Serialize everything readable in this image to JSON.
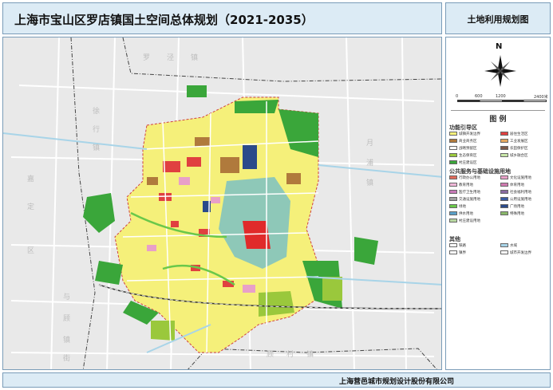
{
  "header": {
    "title": "上海市宝山区罗店镇国土空间总体规划（2021-2035）",
    "map_type": "土地利用规划图"
  },
  "footer": {
    "company": "上海营邑城市规划设计股份有限公司"
  },
  "map": {
    "watermarks": [
      {
        "text": "罗",
        "ix": 0
      },
      {
        "text": "泾",
        "ix": 1
      },
      {
        "text": "镇",
        "ix": 2
      },
      {
        "text": "徐",
        "ix": 3
      },
      {
        "text": "行",
        "ix": 4
      },
      {
        "text": "镇",
        "ix": 5
      },
      {
        "text": "嘉",
        "ix": 6
      },
      {
        "text": "定",
        "ix": 7
      },
      {
        "text": "区",
        "ix": 8
      },
      {
        "text": "与",
        "ix": 9
      },
      {
        "text": "顾",
        "ix": 10
      },
      {
        "text": "镇",
        "ix": 11
      },
      {
        "text": "街",
        "ix": 12
      },
      {
        "text": "顾",
        "ix": 13
      },
      {
        "text": "村",
        "ix": 14
      },
      {
        "text": "镇",
        "ix": 15
      },
      {
        "text": "月",
        "ix": 16
      },
      {
        "text": "浦",
        "ix": 17
      },
      {
        "text": "镇",
        "ix": 18
      }
    ]
  },
  "legend": {
    "compass_label": "N",
    "scale_labels": [
      "0",
      "600",
      "1200",
      "2400米"
    ],
    "title": "图   例",
    "section1_title": "功能引导区",
    "section1_items": [
      {
        "label": "城镇开发边界",
        "color": "#f5f07a"
      },
      {
        "label": "居住生活区",
        "color": "#e04040"
      },
      {
        "label": "商业商务区",
        "color": "#b07a3c"
      },
      {
        "label": "工业发展区",
        "color": "#e3a860"
      },
      {
        "label": "战略预留区",
        "color": "#ffffff"
      },
      {
        "label": "农田保护区",
        "color": "#7b5a4a"
      },
      {
        "label": "生态保育区",
        "color": "#9ac83c"
      },
      {
        "label": "城乡融合区",
        "color": "#c8e6a8"
      },
      {
        "label": "村庄建设区",
        "color": "#3aa63a"
      }
    ],
    "section2_title": "公共服务与基础设施用地",
    "section2_items": [
      {
        "label": "行政办公用地",
        "color": "#e06a5a"
      },
      {
        "label": "文化设施用地",
        "color": "#e8a0c8"
      },
      {
        "label": "教育用地",
        "color": "#f0b8d8"
      },
      {
        "label": "体育用地",
        "color": "#d07ab0"
      },
      {
        "label": "医疗卫生用地",
        "color": "#c87ab8"
      },
      {
        "label": "社会福利用地",
        "color": "#8a6aa0"
      },
      {
        "label": "交通设施用地",
        "color": "#a0a0a0"
      },
      {
        "label": "公用设施用地",
        "color": "#3a5aa0"
      },
      {
        "label": "绿地",
        "color": "#6ac84a"
      },
      {
        "label": "广场用地",
        "color": "#2a4a8a"
      },
      {
        "label": "供水用地",
        "color": "#5aa0c8"
      },
      {
        "label": "特殊用地",
        "color": "#8ab86a"
      },
      {
        "label": "村庄建设用地",
        "color": "#b8d8a0"
      }
    ],
    "section3_title": "其他",
    "section3_items": [
      {
        "label": "铁路",
        "color": "#ffffff"
      },
      {
        "label": "水域",
        "color": "#a8d4e8"
      },
      {
        "label": "镇界",
        "color": "#ffffff"
      },
      {
        "label": "城市开发边界",
        "color": "#ffffff"
      }
    ]
  }
}
